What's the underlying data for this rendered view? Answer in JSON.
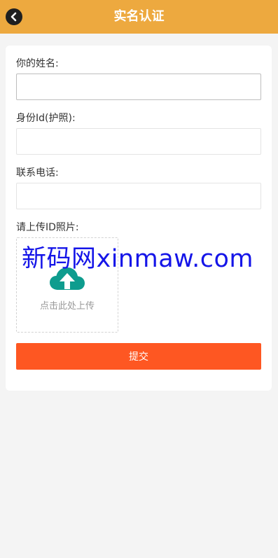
{
  "header": {
    "title": "实名认证",
    "back_icon": "chevron-left-circle-icon",
    "background_color": "#eda93f"
  },
  "form": {
    "name_label": "你的姓名:",
    "name_value": "",
    "id_label": "身份Id(护照):",
    "id_value": "",
    "phone_label": "联系电话:",
    "phone_value": "",
    "photo_label": "请上传ID照片:",
    "upload_icon": "cloud-upload-icon",
    "upload_text": "点击此处上传",
    "upload_icon_color": "#0e9c8e",
    "submit_label": "提交",
    "submit_color": "#fe5722"
  },
  "watermark": {
    "text": "新码网xinmaw.com",
    "color": "#1515e8"
  }
}
